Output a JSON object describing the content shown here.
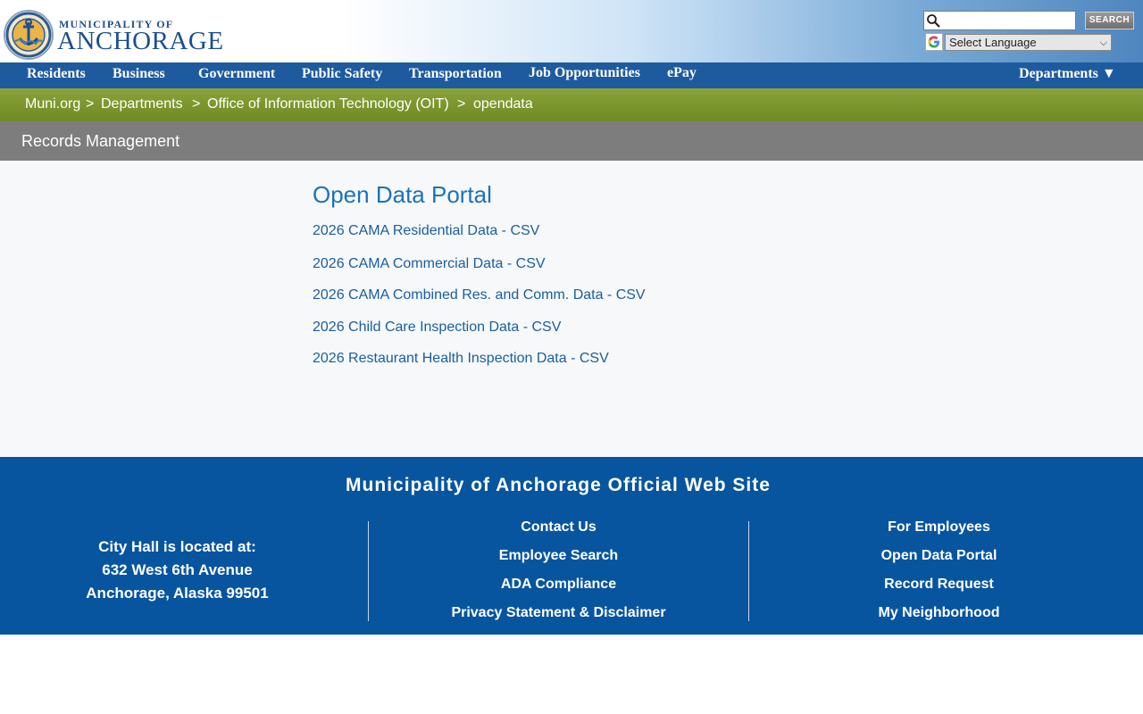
{
  "header": {
    "brand_top": "MUNICIPALITY OF",
    "brand_main": "ANCHORAGE",
    "search_placeholder": "",
    "search_button": "SEARCH",
    "language_select": "Select Language"
  },
  "nav": {
    "items": [
      "Residents",
      "Business",
      "Government",
      "Public Safety",
      "Transportation",
      "Job Opportunities",
      "ePay"
    ],
    "departments": "Departments ▼"
  },
  "breadcrumb": {
    "items": [
      "Muni.org",
      "Departments",
      "Office of Information Technology (OIT)",
      "opendata"
    ],
    "separator": ">"
  },
  "section": {
    "title": "Records Management"
  },
  "main": {
    "title": "Open Data Portal",
    "links": [
      "2026 CAMA Residential Data - CSV",
      "2026 CAMA Commercial Data - CSV",
      "2026 CAMA Combined Res. and Comm. Data - CSV",
      "2026 Child Care Inspection Data - CSV",
      "2026 Restaurant Health Inspection Data - CSV"
    ]
  },
  "footer": {
    "title": "Municipality of Anchorage Official Web Site",
    "address": [
      "City Hall is located at:",
      "632 West 6th Avenue",
      "Anchorage, Alaska 99501"
    ],
    "col2": [
      "Contact Us",
      "Employee Search",
      "ADA Compliance",
      "Privacy Statement & Disclaimer"
    ],
    "col3": [
      "For Employees",
      "Open Data Portal",
      "Record Request",
      "My Neighborhood"
    ]
  },
  "colors": {
    "nav_bg": "#1e5a9e",
    "breadcrumb_bg": "#7b962c",
    "section_bg": "#7d7d7d",
    "link": "#1a5e9e",
    "title": "#1a73b8",
    "footer_bg": "#08559f"
  }
}
